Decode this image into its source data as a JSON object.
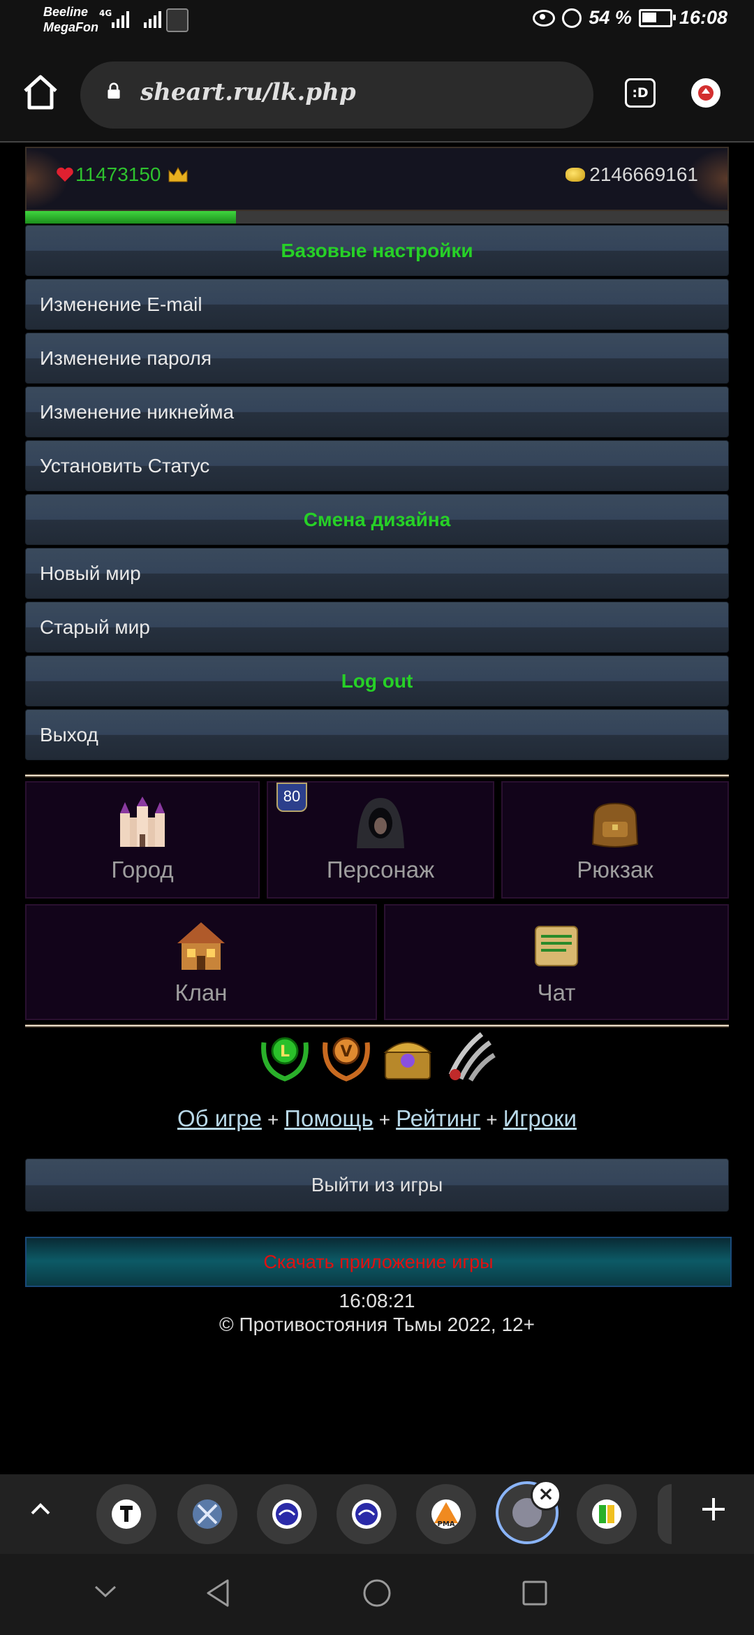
{
  "status_bar": {
    "carrier_1": "Beeline",
    "carrier_2": "MegaFon",
    "network": "4G",
    "battery": "54 %",
    "time": "16:08"
  },
  "browser": {
    "url": "sheart.ru/lk.php",
    "ext_label": ":D"
  },
  "game": {
    "hp": "11473150",
    "gold": "2146669161",
    "progress": 0.3
  },
  "menu": {
    "items": [
      {
        "label": "Базовые настройки",
        "header": true
      },
      {
        "label": "Изменение E-mail",
        "header": false
      },
      {
        "label": "Изменение пароля",
        "header": false
      },
      {
        "label": "Изменение никнейма",
        "header": false
      },
      {
        "label": "Установить Статус",
        "header": false
      },
      {
        "label": "Смена дизайна",
        "header": true
      },
      {
        "label": "Новый мир",
        "header": false
      },
      {
        "label": "Старый мир",
        "header": false
      },
      {
        "label": "Log out",
        "header": true
      },
      {
        "label": "Выход",
        "header": false
      }
    ]
  },
  "tiles": {
    "city": "Город",
    "character": "Персонаж",
    "character_level": "80",
    "backpack": "Рюкзак",
    "clan": "Клан",
    "chat": "Чат"
  },
  "links": {
    "about": "Об игре",
    "help": "Помощь",
    "rating": "Рейтинг",
    "players": "Игроки",
    "separator": "+"
  },
  "exit_button": "Выйти из игры",
  "download_button": "Скачать приложение игры",
  "footer": {
    "time": "16:08:21",
    "copyright": "© Противостояния Тьмы 2022, 12+"
  },
  "tabs": {
    "icons": [
      "t-icon",
      "swords-icon",
      "mint-swirl-icon",
      "mint-swirl-icon",
      "pma-icon",
      "game-icon",
      "leaf-icon"
    ],
    "pma_label": "PMA"
  },
  "colors": {
    "accent_green": "#27d027",
    "hp_green": "#2ec22e",
    "download_red": "#e01010",
    "tab_active": "#8ab4f8"
  }
}
